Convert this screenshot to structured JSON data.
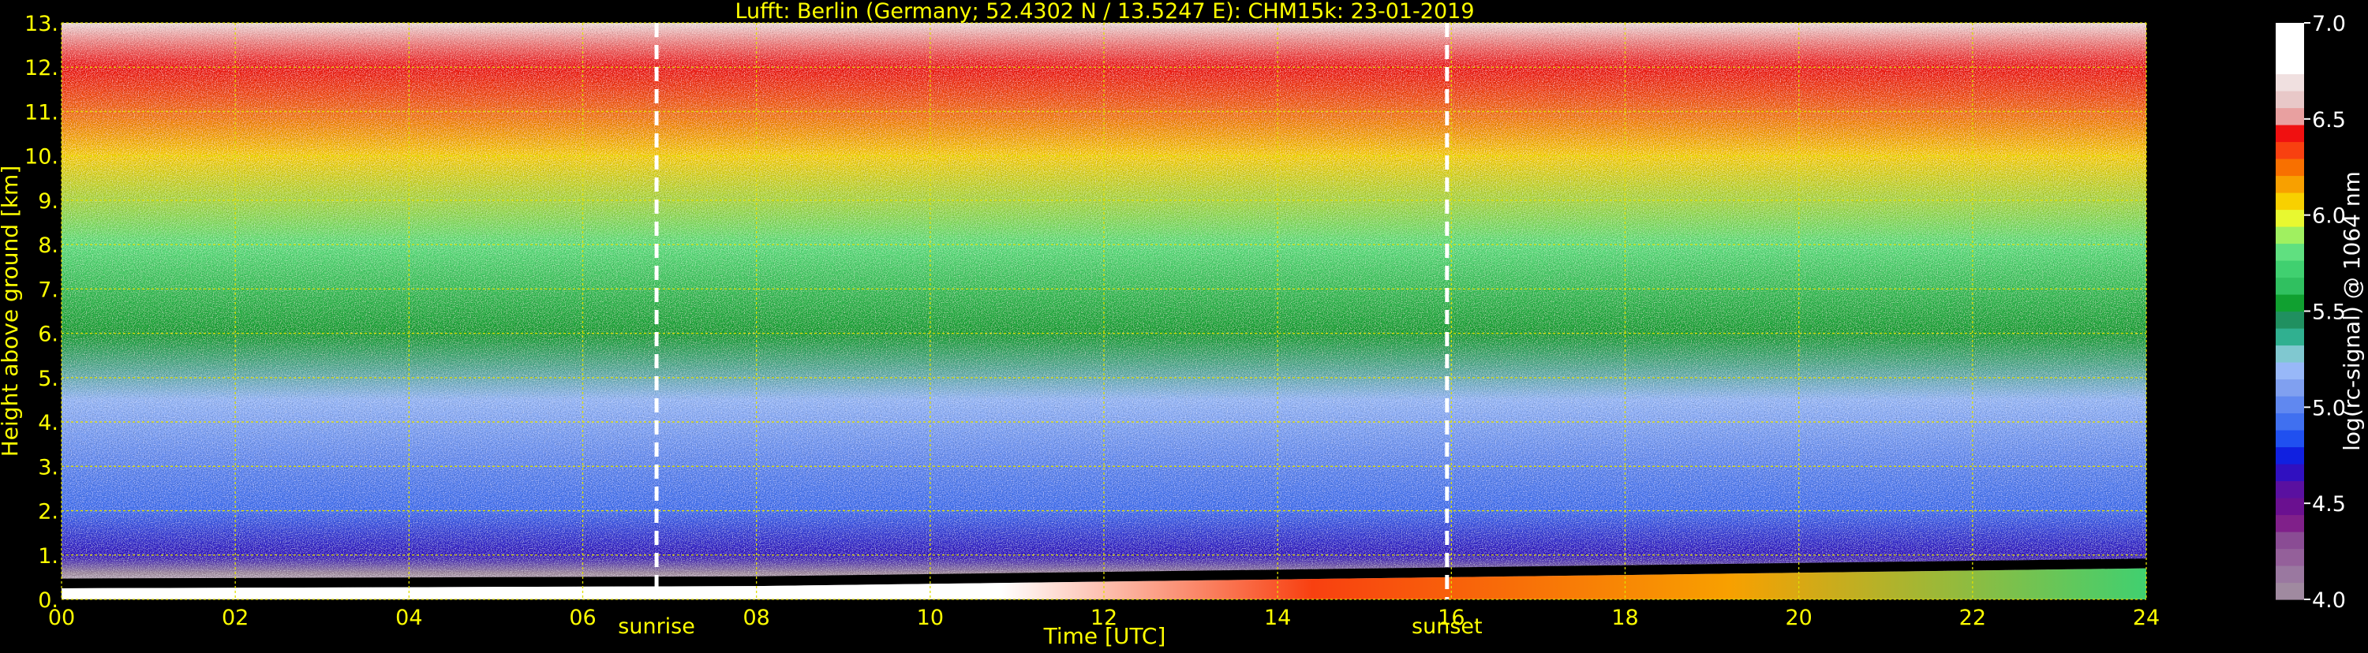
{
  "chart_data": {
    "type": "heatmap",
    "title": "Lufft: Berlin (Germany; 52.4302 N / 13.5247 E):    CHM15k: 23-01-2019",
    "xlabel": "Time [UTC]",
    "ylabel": "Height above ground [km]",
    "x_ticks": [
      "00",
      "02",
      "04",
      "06",
      "08",
      "10",
      "12",
      "14",
      "16",
      "18",
      "20",
      "22",
      "24"
    ],
    "x_range": [
      0,
      24
    ],
    "y_ticks": [
      "0.",
      "1.",
      "2.",
      "3.",
      "4.",
      "5.",
      "6.",
      "7.",
      "8.",
      "9.",
      "10.",
      "11.",
      "12.",
      "13."
    ],
    "y_range": [
      0,
      13
    ],
    "grid": true,
    "annotations": [
      {
        "label": "sunrise",
        "time": 6.85
      },
      {
        "label": "sunset",
        "time": 15.95
      }
    ],
    "colorbar": {
      "label": "log(rc-signal) @ 1064 nm",
      "range": [
        4.0,
        7.0
      ],
      "ticks": [
        "4.0",
        "4.5",
        "5.0",
        "5.5",
        "6.0",
        "6.5",
        "7.0"
      ],
      "colors": [
        "#a08aa0",
        "#9a78a0",
        "#94609a",
        "#8a4c94",
        "#80208a",
        "#6a1090",
        "#5a10a0",
        "#3010c0",
        "#1020e0",
        "#2050f0",
        "#4070f0",
        "#6088f0",
        "#80a0f0",
        "#98b8f8",
        "#80c8d0",
        "#30b090",
        "#209060",
        "#10a030",
        "#30c060",
        "#40d070",
        "#60e080",
        "#a0f060",
        "#e8f830",
        "#f8d000",
        "#f8a000",
        "#f87000",
        "#f84010",
        "#f01010",
        "#e8a0a0",
        "#e8c8c8",
        "#f0e0e0",
        "#ffffff",
        "#ffffff",
        "#ffffff"
      ]
    },
    "signal_profile": [
      {
        "height": 0.1,
        "value": 6.9
      },
      {
        "height": 0.6,
        "value": 4.0
      },
      {
        "height": 1.0,
        "value": 4.7
      },
      {
        "height": 2.0,
        "value": 4.9
      },
      {
        "height": 3.0,
        "value": 5.0
      },
      {
        "height": 4.5,
        "value": 5.2
      },
      {
        "height": 6.0,
        "value": 5.5
      },
      {
        "height": 8.0,
        "value": 5.8
      },
      {
        "height": 10.0,
        "value": 6.1
      },
      {
        "height": 12.0,
        "value": 6.4
      },
      {
        "height": 13.0,
        "value": 6.7
      }
    ],
    "boundary_layer_top": [
      {
        "time": 0,
        "height": 0.25
      },
      {
        "time": 8,
        "height": 0.3
      },
      {
        "time": 14,
        "height": 0.45
      },
      {
        "time": 18,
        "height": 0.55
      },
      {
        "time": 24,
        "height": 0.7
      }
    ]
  }
}
